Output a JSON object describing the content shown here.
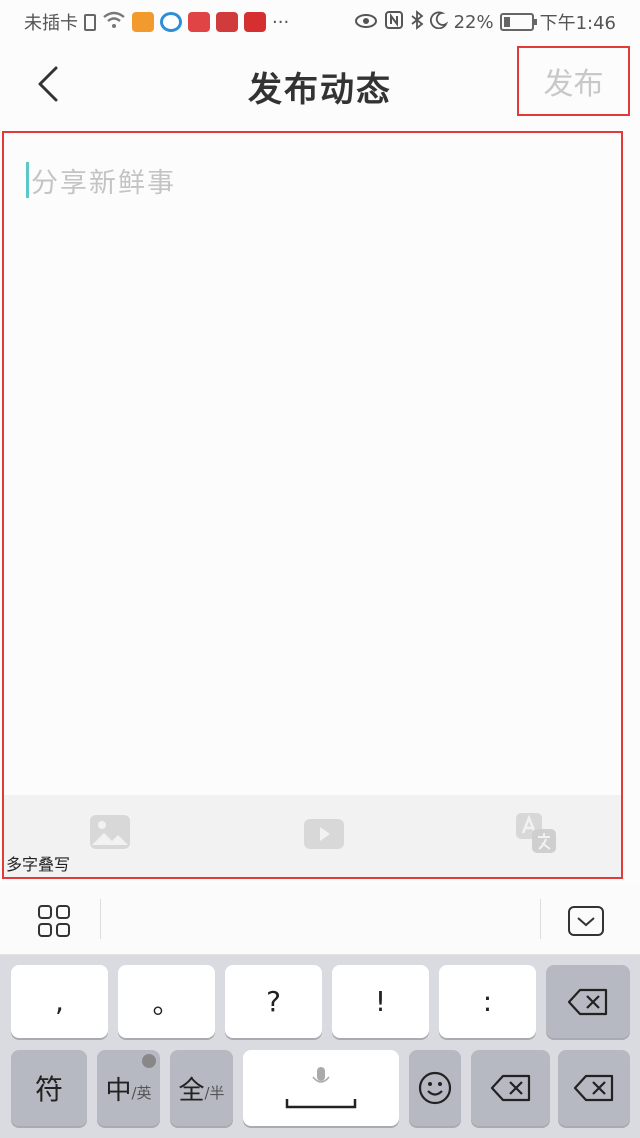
{
  "status_bar": {
    "carrier": "未插卡",
    "battery_percent": "22%",
    "battery_level": 0.22,
    "time": "下午1:46",
    "more": "···",
    "icons": [
      "sim-card-icon",
      "wifi-icon",
      "app-icon-orange",
      "app-icon-blue",
      "app-icon-red-news",
      "app-icon-red-heart",
      "app-icon-red-d",
      "eye-icon",
      "nfc-icon",
      "bluetooth-icon",
      "moon-icon",
      "battery-icon"
    ]
  },
  "nav": {
    "back_icon": "chevron-left-icon",
    "title": "发布动态",
    "publish_label": "发布"
  },
  "compose": {
    "placeholder": "分享新鲜事",
    "value": "",
    "tools": [
      "image-icon",
      "video-icon",
      "translate-icon"
    ],
    "hint": "多字叠写"
  },
  "keyboard": {
    "candidate_bar": {
      "menu_icon": "grid-menu-icon",
      "hide_icon": "keyboard-hide-icon"
    },
    "row1": [
      ",",
      "。",
      "?",
      "!",
      ":"
    ],
    "row1_backspace_icon": "backspace-icon",
    "row2": {
      "symbol": "符",
      "lang_main": "中",
      "lang_sub": "/英",
      "width_main": "全",
      "width_sub": "/半",
      "space_mic_icon": "microphone-icon",
      "emoji_icon": "emoji-icon",
      "backspace_icon": "backspace-icon"
    }
  },
  "colors": {
    "highlight_border": "#e23a3a",
    "placeholder": "#c4c4c4",
    "caret": "#5cc7c7",
    "keyboard_bg": "#d9dbe0"
  }
}
